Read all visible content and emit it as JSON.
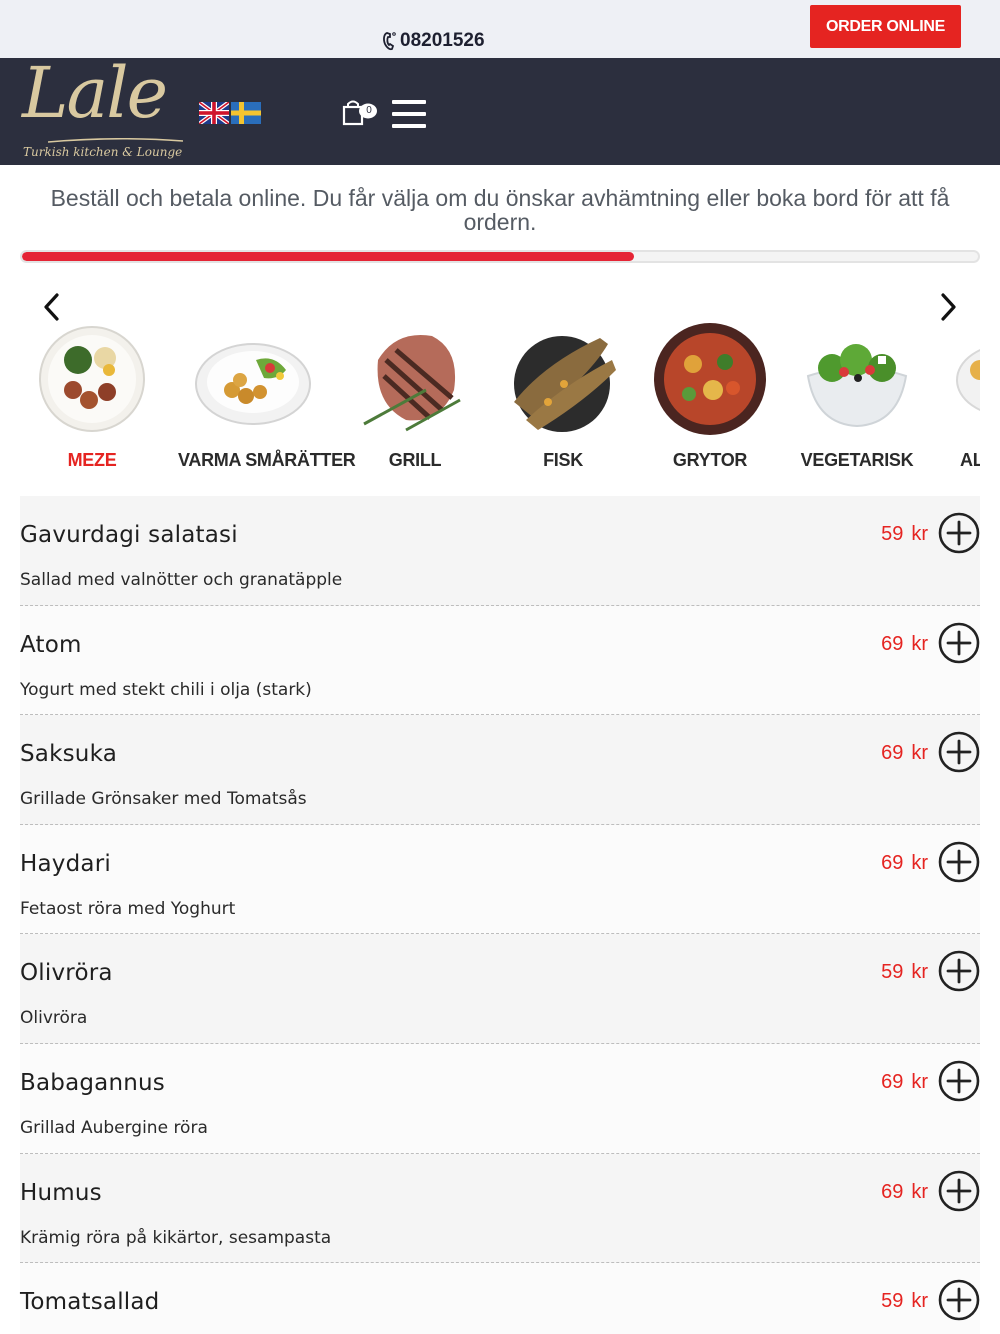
{
  "topbar": {
    "phone": "08201526",
    "order_button": "ORDER ONLINE"
  },
  "header": {
    "logo_text": "Lale",
    "logo_tagline": "Turkish kitchen & Lounge",
    "cart_count": "0",
    "flags": [
      "uk-flag-icon",
      "sweden-flag-icon"
    ]
  },
  "intro": {
    "text": "Beställ och betala online. Du får välja om du önskar avhämtning eller boka bord för att få ordern.",
    "progress_fraction": 0.64
  },
  "categories": [
    {
      "label": "MEZE",
      "active": true,
      "icon": "meze-plate-icon"
    },
    {
      "label": "VARMA SMÅRÄTTER",
      "active": false,
      "icon": "warm-dish-plate-icon"
    },
    {
      "label": "GRILL",
      "active": false,
      "icon": "grilled-steak-icon"
    },
    {
      "label": "FISK",
      "active": false,
      "icon": "grilled-fish-icon"
    },
    {
      "label": "GRYTOR",
      "active": false,
      "icon": "stew-pot-icon"
    },
    {
      "label": "VEGETARISK",
      "active": false,
      "icon": "salad-bowl-icon"
    },
    {
      "label": "AL",
      "active": false,
      "icon": "partial-dish-icon"
    }
  ],
  "menu": {
    "currency": "kr",
    "items": [
      {
        "name": "Gavurdagi salatasi",
        "desc": "Sallad med valnötter och granatäpple",
        "price": "59"
      },
      {
        "name": "Atom",
        "desc": "Yogurt med stekt chili i olja (stark)",
        "price": "69"
      },
      {
        "name": "Saksuka",
        "desc": "Grillade Grönsaker med Tomatsås",
        "price": "69"
      },
      {
        "name": "Haydari",
        "desc": "Fetaost röra med Yoghurt",
        "price": "69"
      },
      {
        "name": "Olivröra",
        "desc": "Olivröra",
        "price": "59"
      },
      {
        "name": "Babagannus",
        "desc": "Grillad Aubergine röra",
        "price": "69"
      },
      {
        "name": "Humus",
        "desc": "Krämig röra på kikärtor, sesampasta",
        "price": "69"
      },
      {
        "name": "Tomatsallad",
        "desc": "",
        "price": "59"
      }
    ]
  },
  "colors": {
    "brand_red": "#e52421",
    "header_bg": "#2c2f3e",
    "logo_gold": "#d9c9a0"
  }
}
